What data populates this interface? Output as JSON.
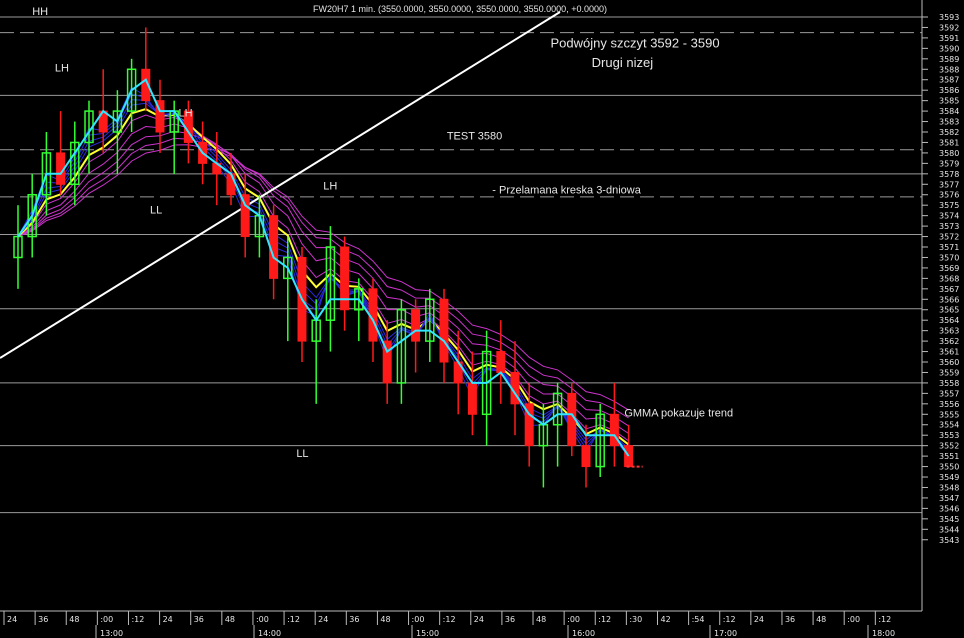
{
  "chart_data": {
    "type": "candlestick",
    "title": "FW20H7 1 min. (3550.0000, 3550.0000, 3550.0000, 3550.0000, +0.0000)",
    "ylim": [
      3542,
      3594
    ],
    "y_ticks": [
      3543,
      3544,
      3545,
      3546,
      3547,
      3548,
      3549,
      3550,
      3551,
      3552,
      3553,
      3554,
      3555,
      3556,
      3557,
      3558,
      3559,
      3560,
      3561,
      3562,
      3563,
      3564,
      3565,
      3566,
      3567,
      3568,
      3569,
      3570,
      3571,
      3572,
      3573,
      3574,
      3575,
      3576,
      3577,
      3578,
      3579,
      3580,
      3581,
      3582,
      3583,
      3584,
      3585,
      3586,
      3587,
      3588,
      3589,
      3590,
      3591,
      3592,
      3593
    ],
    "x_minor_ticks": [
      "24",
      "36",
      "48",
      ":00",
      ":12",
      "24",
      "36",
      "48",
      ":00",
      ":12",
      "24",
      "36",
      "48",
      ":00",
      ":12",
      "24",
      "36",
      "48",
      ":00",
      ":12",
      ":30",
      "42",
      ":54",
      ":12",
      "24",
      "36",
      "48",
      ":00",
      ":12"
    ],
    "x_major_ticks": [
      "13:00",
      "14:00",
      "15:00",
      "16:00",
      "17:00",
      "18:00"
    ],
    "horizontal_levels": [
      3593,
      3585.5,
      3578,
      3572.2,
      3565.1,
      3558,
      3552,
      3545.6
    ],
    "dashed_levels": [
      3591.5,
      3580.3,
      3575.8
    ],
    "candles": [
      [
        3570,
        3575,
        3567,
        3572
      ],
      [
        3572,
        3578,
        3570,
        3576
      ],
      [
        3576,
        3582,
        3574,
        3580
      ],
      [
        3580,
        3584,
        3576,
        3577
      ],
      [
        3577,
        3583,
        3575,
        3581
      ],
      [
        3581,
        3585,
        3578,
        3584
      ],
      [
        3584,
        3588,
        3580,
        3582
      ],
      [
        3582,
        3586,
        3578,
        3584
      ],
      [
        3584,
        3589,
        3582,
        3588
      ],
      [
        3588,
        3592,
        3584,
        3585
      ],
      [
        3585,
        3587,
        3580,
        3582
      ],
      [
        3582,
        3585,
        3578,
        3584
      ],
      [
        3584,
        3585,
        3579,
        3581
      ],
      [
        3581,
        3583,
        3577,
        3579
      ],
      [
        3579,
        3582,
        3575,
        3578
      ],
      [
        3578,
        3580,
        3575,
        3576
      ],
      [
        3576,
        3578,
        3570,
        3572
      ],
      [
        3572,
        3576,
        3570,
        3574
      ],
      [
        3574,
        3575,
        3566,
        3568
      ],
      [
        3568,
        3572,
        3562,
        3570
      ],
      [
        3570,
        3571,
        3560,
        3562
      ],
      [
        3562,
        3566,
        3556,
        3564
      ],
      [
        3564,
        3573,
        3561,
        3571
      ],
      [
        3571,
        3572,
        3563,
        3565
      ],
      [
        3565,
        3568,
        3562,
        3567
      ],
      [
        3567,
        3568,
        3560,
        3562
      ],
      [
        3562,
        3564,
        3556,
        3558
      ],
      [
        3558,
        3566,
        3556,
        3565
      ],
      [
        3565,
        3566,
        3559,
        3562
      ],
      [
        3562,
        3567,
        3560,
        3566
      ],
      [
        3566,
        3567,
        3558,
        3560
      ],
      [
        3560,
        3563,
        3555,
        3558
      ],
      [
        3558,
        3561,
        3553,
        3555
      ],
      [
        3555,
        3563,
        3552,
        3561
      ],
      [
        3561,
        3564,
        3556,
        3559
      ],
      [
        3559,
        3562,
        3553,
        3556
      ],
      [
        3556,
        3558,
        3550,
        3552
      ],
      [
        3552,
        3556,
        3548,
        3554
      ],
      [
        3554,
        3558,
        3550,
        3557
      ],
      [
        3557,
        3558,
        3551,
        3552
      ],
      [
        3552,
        3554,
        3548,
        3550
      ],
      [
        3550,
        3556,
        3549,
        3555
      ],
      [
        3555,
        3558,
        3550,
        3552
      ],
      [
        3552,
        3554,
        3550,
        3550
      ]
    ],
    "ema_trend": [
      3572,
      3574,
      3578,
      3578,
      3580,
      3582,
      3584,
      3583,
      3586,
      3587,
      3584,
      3584,
      3582,
      3580,
      3579,
      3578,
      3575,
      3574,
      3570,
      3569,
      3566,
      3564,
      3566,
      3566,
      3566,
      3564,
      3561,
      3562,
      3563,
      3563,
      3562,
      3560,
      3558,
      3558,
      3559,
      3557,
      3555,
      3554,
      3555,
      3555,
      3553,
      3553,
      3553,
      3551
    ],
    "annotations": [
      {
        "text": "HH",
        "x": 1.0,
        "y": 3593.2
      },
      {
        "text": "LH",
        "x": 2.6,
        "y": 3587.8
      },
      {
        "text": "LH",
        "x": 11.3,
        "y": 3583.5
      },
      {
        "text": "LL",
        "x": 9.3,
        "y": 3574.2
      },
      {
        "text": "LH",
        "x": 21.5,
        "y": 3576.5
      },
      {
        "text": "LL",
        "x": 19.6,
        "y": 3550.9
      },
      {
        "text": "TEST 3580",
        "x": 30.2,
        "y": 3581.3
      },
      {
        "text": "- Przelamana kreska 3-dniowa",
        "x": 33.4,
        "y": 3576.1
      },
      {
        "text": "Podwójny szczyt  3592 - 3590",
        "x": 37.5,
        "y": 3590.1
      },
      {
        "text": "Drugi nizej",
        "x": 40.4,
        "y": 3588.2
      },
      {
        "text": "GMMA pokazuje trend",
        "x": 42.7,
        "y": 3554.8
      }
    ]
  }
}
